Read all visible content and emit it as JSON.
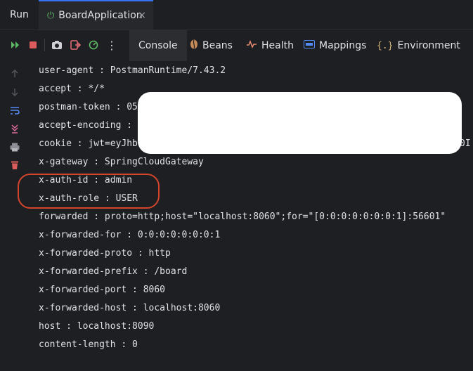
{
  "tabs": {
    "run_label": "Run",
    "app_label": "BoardApplication",
    "app_icon": "spring-boot-icon",
    "close_glyph": "×"
  },
  "toolbar": {
    "buttons": [
      "rerun-icon",
      "stop-icon",
      "screenshot-icon",
      "exit-icon",
      "profiler-icon",
      "more-icon"
    ],
    "tabs": [
      {
        "label": "Console",
        "icon": "none",
        "active": true
      },
      {
        "label": "Beans",
        "icon": "beans-icon",
        "active": false
      },
      {
        "label": "Health",
        "icon": "health-icon",
        "active": false
      },
      {
        "label": "Mappings",
        "icon": "api-icon",
        "active": false
      },
      {
        "label": "Environment",
        "icon": "environment-icon",
        "active": false
      }
    ],
    "colors": {
      "run": "#5fb865",
      "stop": "#db5c5c",
      "exit": "#e06c75"
    }
  },
  "gutter": {
    "buttons": [
      "scroll-up-icon",
      "scroll-down-icon",
      "soft-wrap-icon",
      "scroll-to-end-icon",
      "print-icon",
      "clear-icon"
    ]
  },
  "console": {
    "lines": [
      "user-agent : PostmanRuntime/7.43.2",
      "accept : */*",
      "postman-token : 05",
      "accept-encoding :",
      "cookie : jwt=eyJhb",
      "x-gateway : SpringCloudGateway",
      "x-auth-id : admin",
      "x-auth-role : USER",
      "forwarded : proto=http;host=\"localhost:8060\";for=\"[0:0:0:0:0:0:0:1]:56601\"",
      "x-forwarded-for : 0:0:0:0:0:0:0:1",
      "x-forwarded-proto : http",
      "x-forwarded-prefix : /board",
      "x-forwarded-port : 8060",
      "x-forwarded-host : localhost:8060",
      "host : localhost:8090",
      "content-length : 0"
    ],
    "cookie_tail": "0I",
    "highlight_color": "#d2452c"
  }
}
